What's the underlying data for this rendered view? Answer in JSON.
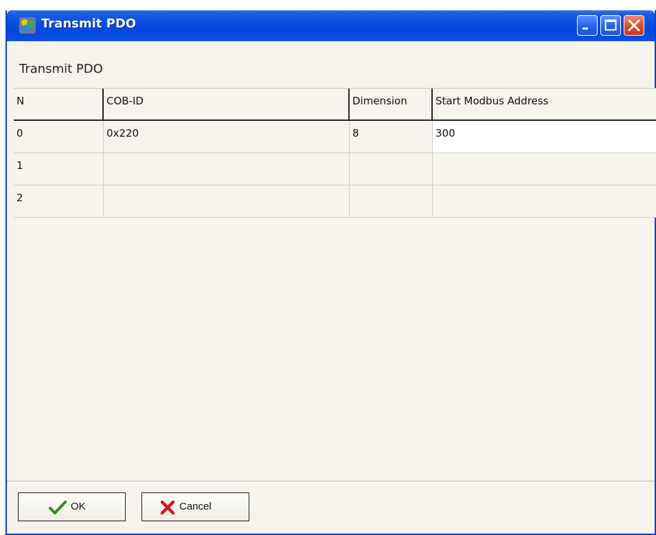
{
  "window": {
    "title": "Transmit PDO",
    "controls": [
      "minimize",
      "maximize",
      "close"
    ]
  },
  "panel": {
    "title": "Transmit PDO"
  },
  "table": {
    "columns": [
      "N",
      "COB-ID",
      "Dimension",
      "Start Modbus Address"
    ],
    "rows": [
      {
        "n": "0",
        "cob_id": "0x220",
        "dimension": "8",
        "start_address": "300"
      },
      {
        "n": "1",
        "cob_id": "",
        "dimension": "",
        "start_address": ""
      },
      {
        "n": "2",
        "cob_id": "",
        "dimension": "",
        "start_address": ""
      }
    ]
  },
  "buttons": {
    "ok_label": "OK",
    "cancel_label": "Cancel"
  },
  "colors": {
    "titlebar": "#0a4ce0",
    "window_bg": "#f5f3ec",
    "ok_icon": "#2f8a1e",
    "cancel_icon": "#d11a1a"
  },
  "icons": {
    "app": "app-icon",
    "ok": "checkmark-icon",
    "cancel": "x-icon"
  }
}
